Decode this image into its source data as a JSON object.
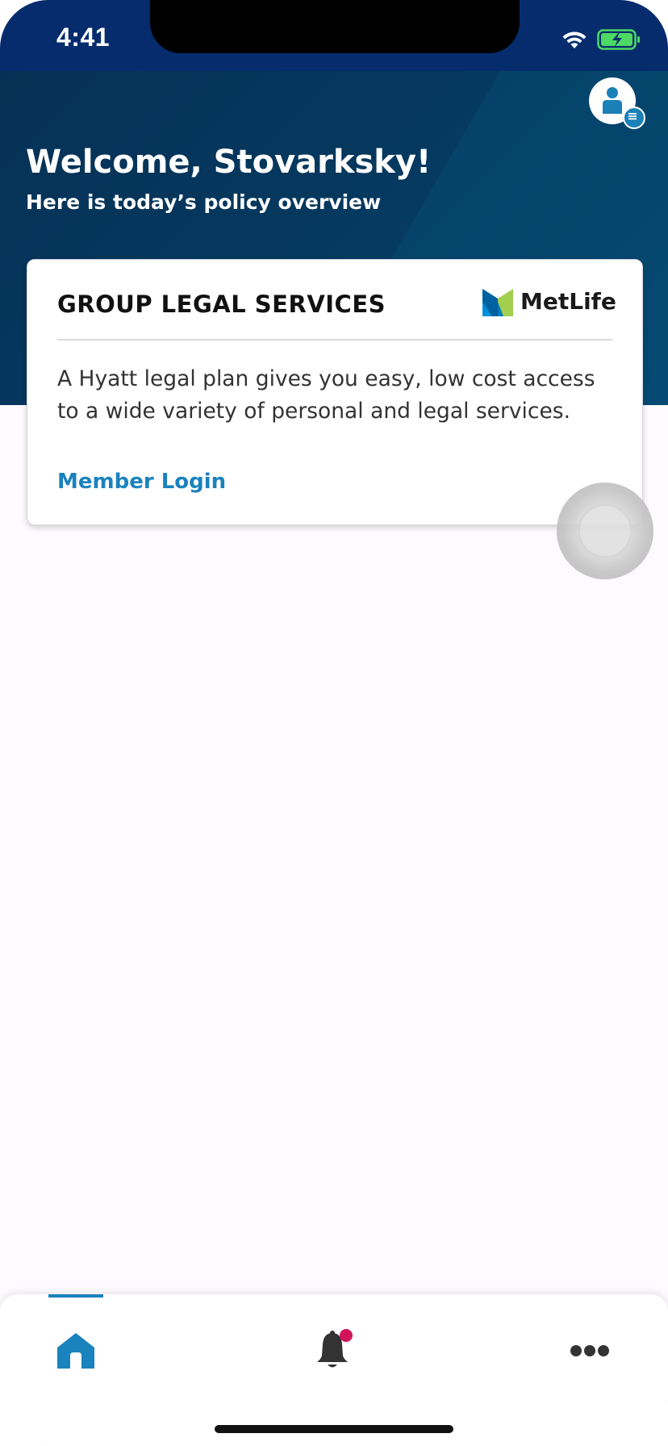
{
  "status_bar": {
    "time": "4:41",
    "wifi_icon": "wifi-icon",
    "battery_icon": "battery-charging-icon"
  },
  "header": {
    "welcome": "Welcome, Stovarksky!",
    "subtitle": "Here is today’s policy overview",
    "avatar_icon": "profile-icon"
  },
  "card": {
    "title": "GROUP LEGAL SERVICES",
    "logo_text": "MetLife",
    "description": "A Hyatt legal plan gives you easy, low cost access to a wide variety of personal and legal services.",
    "link": "Member Login"
  },
  "tabbar": {
    "items": [
      {
        "icon": "home-icon",
        "active": true
      },
      {
        "icon": "bell-icon",
        "has_notification": true
      },
      {
        "icon": "more-icon"
      }
    ]
  },
  "colors": {
    "header_dark": "#063156",
    "status_bar": "#062c6e",
    "accent_blue": "#1a82bd",
    "notification": "#d0155a"
  }
}
